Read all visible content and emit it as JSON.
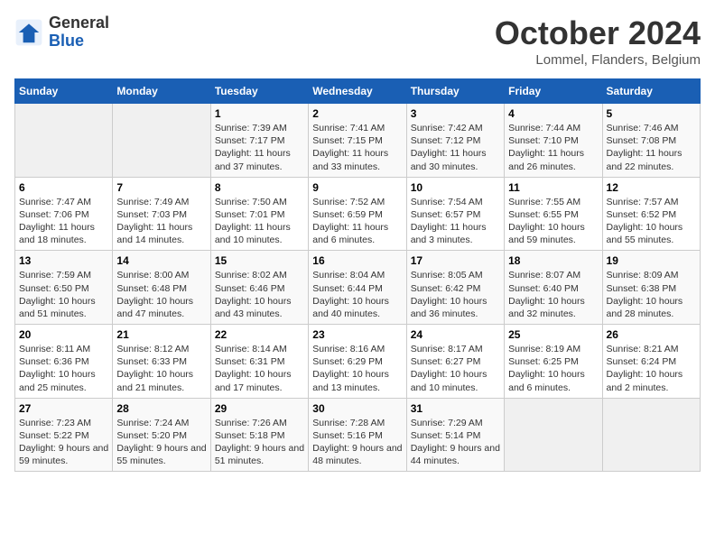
{
  "header": {
    "logo_line1": "General",
    "logo_line2": "Blue",
    "month": "October 2024",
    "location": "Lommel, Flanders, Belgium"
  },
  "weekdays": [
    "Sunday",
    "Monday",
    "Tuesday",
    "Wednesday",
    "Thursday",
    "Friday",
    "Saturday"
  ],
  "weeks": [
    [
      {
        "day": "",
        "info": ""
      },
      {
        "day": "",
        "info": ""
      },
      {
        "day": "1",
        "info": "Sunrise: 7:39 AM\nSunset: 7:17 PM\nDaylight: 11 hours and 37 minutes."
      },
      {
        "day": "2",
        "info": "Sunrise: 7:41 AM\nSunset: 7:15 PM\nDaylight: 11 hours and 33 minutes."
      },
      {
        "day": "3",
        "info": "Sunrise: 7:42 AM\nSunset: 7:12 PM\nDaylight: 11 hours and 30 minutes."
      },
      {
        "day": "4",
        "info": "Sunrise: 7:44 AM\nSunset: 7:10 PM\nDaylight: 11 hours and 26 minutes."
      },
      {
        "day": "5",
        "info": "Sunrise: 7:46 AM\nSunset: 7:08 PM\nDaylight: 11 hours and 22 minutes."
      }
    ],
    [
      {
        "day": "6",
        "info": "Sunrise: 7:47 AM\nSunset: 7:06 PM\nDaylight: 11 hours and 18 minutes."
      },
      {
        "day": "7",
        "info": "Sunrise: 7:49 AM\nSunset: 7:03 PM\nDaylight: 11 hours and 14 minutes."
      },
      {
        "day": "8",
        "info": "Sunrise: 7:50 AM\nSunset: 7:01 PM\nDaylight: 11 hours and 10 minutes."
      },
      {
        "day": "9",
        "info": "Sunrise: 7:52 AM\nSunset: 6:59 PM\nDaylight: 11 hours and 6 minutes."
      },
      {
        "day": "10",
        "info": "Sunrise: 7:54 AM\nSunset: 6:57 PM\nDaylight: 11 hours and 3 minutes."
      },
      {
        "day": "11",
        "info": "Sunrise: 7:55 AM\nSunset: 6:55 PM\nDaylight: 10 hours and 59 minutes."
      },
      {
        "day": "12",
        "info": "Sunrise: 7:57 AM\nSunset: 6:52 PM\nDaylight: 10 hours and 55 minutes."
      }
    ],
    [
      {
        "day": "13",
        "info": "Sunrise: 7:59 AM\nSunset: 6:50 PM\nDaylight: 10 hours and 51 minutes."
      },
      {
        "day": "14",
        "info": "Sunrise: 8:00 AM\nSunset: 6:48 PM\nDaylight: 10 hours and 47 minutes."
      },
      {
        "day": "15",
        "info": "Sunrise: 8:02 AM\nSunset: 6:46 PM\nDaylight: 10 hours and 43 minutes."
      },
      {
        "day": "16",
        "info": "Sunrise: 8:04 AM\nSunset: 6:44 PM\nDaylight: 10 hours and 40 minutes."
      },
      {
        "day": "17",
        "info": "Sunrise: 8:05 AM\nSunset: 6:42 PM\nDaylight: 10 hours and 36 minutes."
      },
      {
        "day": "18",
        "info": "Sunrise: 8:07 AM\nSunset: 6:40 PM\nDaylight: 10 hours and 32 minutes."
      },
      {
        "day": "19",
        "info": "Sunrise: 8:09 AM\nSunset: 6:38 PM\nDaylight: 10 hours and 28 minutes."
      }
    ],
    [
      {
        "day": "20",
        "info": "Sunrise: 8:11 AM\nSunset: 6:36 PM\nDaylight: 10 hours and 25 minutes."
      },
      {
        "day": "21",
        "info": "Sunrise: 8:12 AM\nSunset: 6:33 PM\nDaylight: 10 hours and 21 minutes."
      },
      {
        "day": "22",
        "info": "Sunrise: 8:14 AM\nSunset: 6:31 PM\nDaylight: 10 hours and 17 minutes."
      },
      {
        "day": "23",
        "info": "Sunrise: 8:16 AM\nSunset: 6:29 PM\nDaylight: 10 hours and 13 minutes."
      },
      {
        "day": "24",
        "info": "Sunrise: 8:17 AM\nSunset: 6:27 PM\nDaylight: 10 hours and 10 minutes."
      },
      {
        "day": "25",
        "info": "Sunrise: 8:19 AM\nSunset: 6:25 PM\nDaylight: 10 hours and 6 minutes."
      },
      {
        "day": "26",
        "info": "Sunrise: 8:21 AM\nSunset: 6:24 PM\nDaylight: 10 hours and 2 minutes."
      }
    ],
    [
      {
        "day": "27",
        "info": "Sunrise: 7:23 AM\nSunset: 5:22 PM\nDaylight: 9 hours and 59 minutes."
      },
      {
        "day": "28",
        "info": "Sunrise: 7:24 AM\nSunset: 5:20 PM\nDaylight: 9 hours and 55 minutes."
      },
      {
        "day": "29",
        "info": "Sunrise: 7:26 AM\nSunset: 5:18 PM\nDaylight: 9 hours and 51 minutes."
      },
      {
        "day": "30",
        "info": "Sunrise: 7:28 AM\nSunset: 5:16 PM\nDaylight: 9 hours and 48 minutes."
      },
      {
        "day": "31",
        "info": "Sunrise: 7:29 AM\nSunset: 5:14 PM\nDaylight: 9 hours and 44 minutes."
      },
      {
        "day": "",
        "info": ""
      },
      {
        "day": "",
        "info": ""
      }
    ]
  ]
}
